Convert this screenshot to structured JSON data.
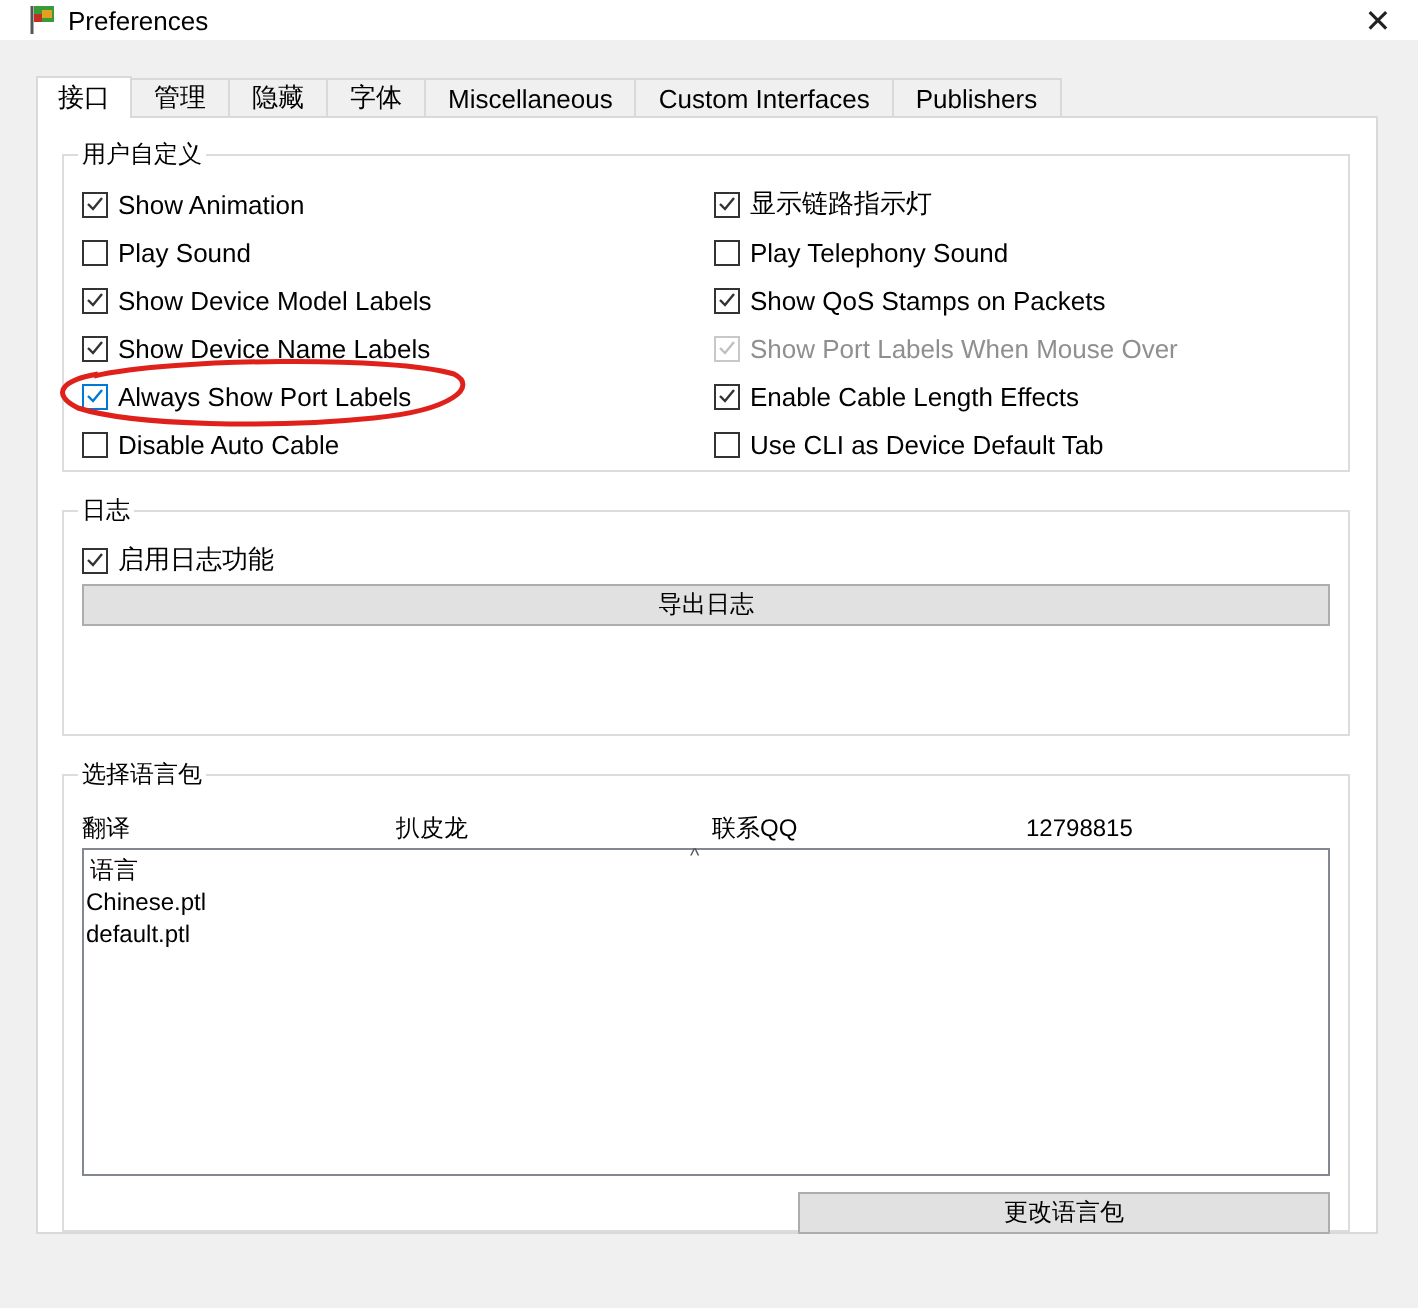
{
  "window": {
    "title": "Preferences",
    "close": "✕"
  },
  "tabs": [
    {
      "label": "接口",
      "selected": true
    },
    {
      "label": "管理",
      "selected": false
    },
    {
      "label": "隐藏",
      "selected": false
    },
    {
      "label": "字体",
      "selected": false
    },
    {
      "label": "Miscellaneous",
      "selected": false
    },
    {
      "label": "Custom Interfaces",
      "selected": false
    },
    {
      "label": "Publishers",
      "selected": false
    }
  ],
  "custom_group": {
    "title": "用户自定义",
    "left_options": [
      {
        "label": "Show Animation",
        "checked": true,
        "disabled": false,
        "circled": false
      },
      {
        "label": "Play Sound",
        "checked": false,
        "disabled": false,
        "circled": false
      },
      {
        "label": "Show Device Model Labels",
        "checked": true,
        "disabled": false,
        "circled": false
      },
      {
        "label": "Show Device Name Labels",
        "checked": true,
        "disabled": false,
        "circled": false
      },
      {
        "label": "Always Show Port Labels",
        "checked": true,
        "disabled": false,
        "circled": true
      },
      {
        "label": "Disable Auto Cable",
        "checked": false,
        "disabled": false,
        "circled": false
      }
    ],
    "right_options": [
      {
        "label": "显示链路指示灯",
        "checked": true,
        "disabled": false,
        "circled": false
      },
      {
        "label": "Play Telephony Sound",
        "checked": false,
        "disabled": false,
        "circled": false
      },
      {
        "label": "Show QoS Stamps on Packets",
        "checked": true,
        "disabled": false,
        "circled": false
      },
      {
        "label": "Show Port Labels When Mouse Over",
        "checked": true,
        "disabled": true,
        "circled": false
      },
      {
        "label": "Enable Cable Length Effects",
        "checked": true,
        "disabled": false,
        "circled": false
      },
      {
        "label": "Use CLI as Device Default Tab",
        "checked": false,
        "disabled": false,
        "circled": false
      }
    ]
  },
  "log_group": {
    "title": "日志",
    "option": {
      "label": "启用日志功能",
      "checked": true
    },
    "button": "导出日志"
  },
  "language_group": {
    "title": "选择语言包",
    "info": [
      "翻译",
      "扒皮龙",
      "联系QQ",
      "12798815"
    ],
    "list": {
      "sort_indicator": "^",
      "header": "语言",
      "items": [
        "Chinese.ptl",
        "default.ptl"
      ]
    },
    "button": "更改语言包"
  }
}
